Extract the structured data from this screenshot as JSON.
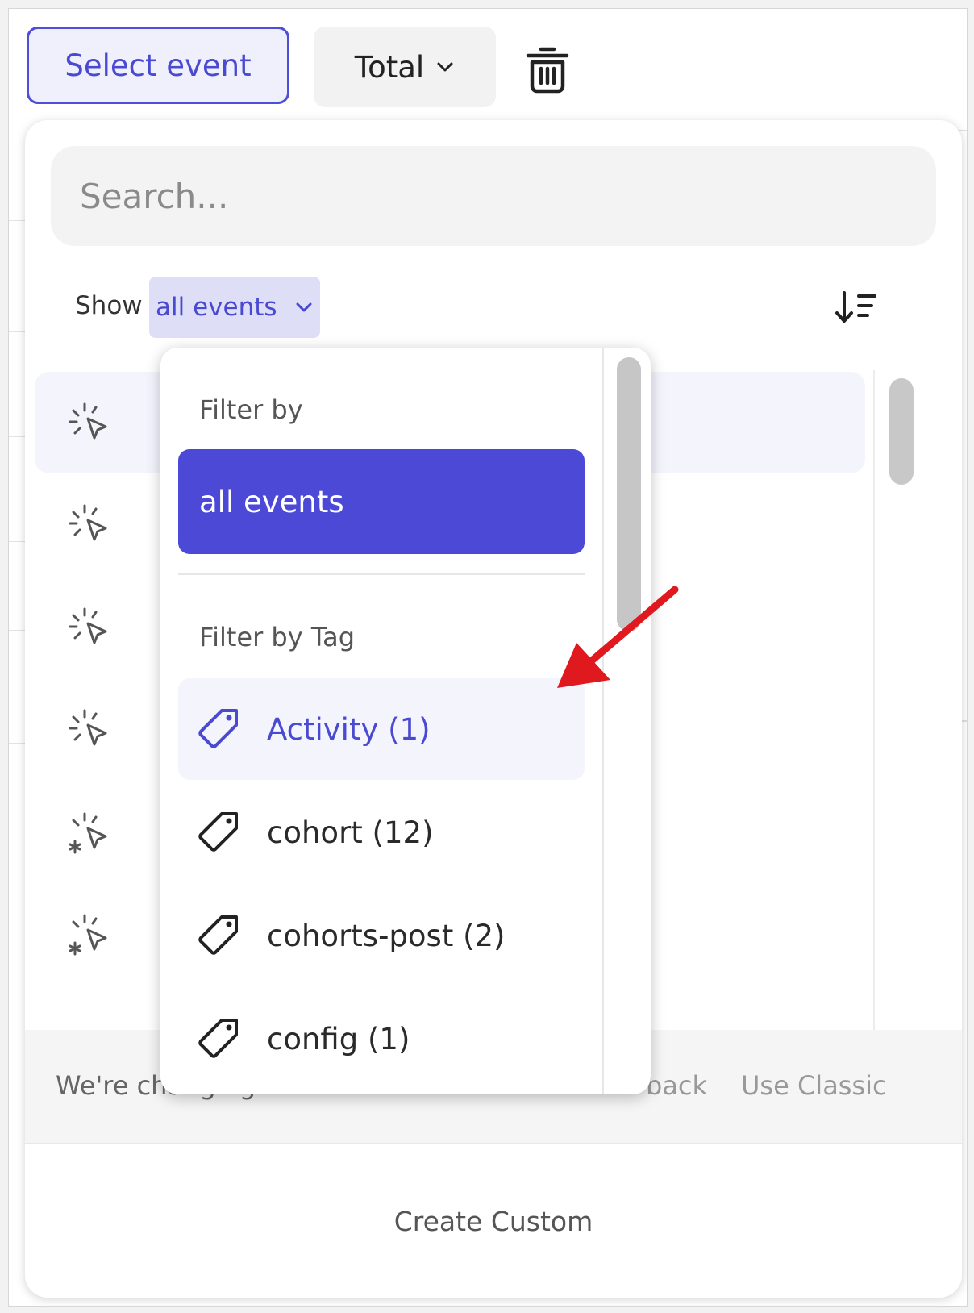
{
  "toolbar": {
    "select_event_label": "Select event",
    "total_label": "Total"
  },
  "panel": {
    "search_placeholder": "Search...",
    "show_label": "Show",
    "show_value": "all events",
    "footer_message": "We're changing",
    "footer_feedback": "back",
    "footer_classic": "Use Classic",
    "create_custom": "Create Custom"
  },
  "dropdown": {
    "filter_by_heading": "Filter by",
    "all_events_label": "all events",
    "filter_by_tag_heading": "Filter by Tag",
    "tags": [
      {
        "label": "Activity (1)"
      },
      {
        "label": "cohort (12)"
      },
      {
        "label": "cohorts-post (2)"
      },
      {
        "label": "config (1)"
      }
    ]
  },
  "colors": {
    "accent": "#4b49d6",
    "arrow": "#e0191f"
  }
}
